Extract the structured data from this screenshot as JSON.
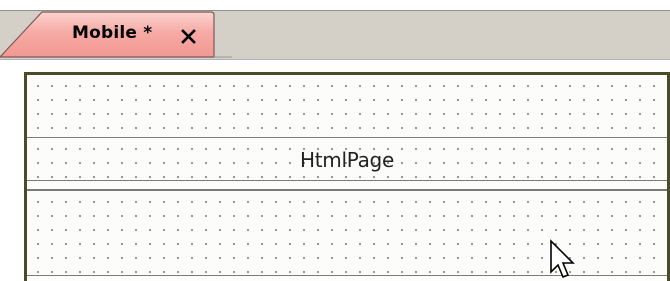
{
  "tab": {
    "label": "Mobile *",
    "close_glyph": "×",
    "active_color": "#f5a5a0",
    "icon": "close-icon"
  },
  "designer": {
    "page_label": "HtmlPage",
    "frame_color": "#4b4b2a",
    "grid_dot_color": "#707070"
  },
  "cursor": {
    "icon": "mouse-pointer-icon"
  }
}
